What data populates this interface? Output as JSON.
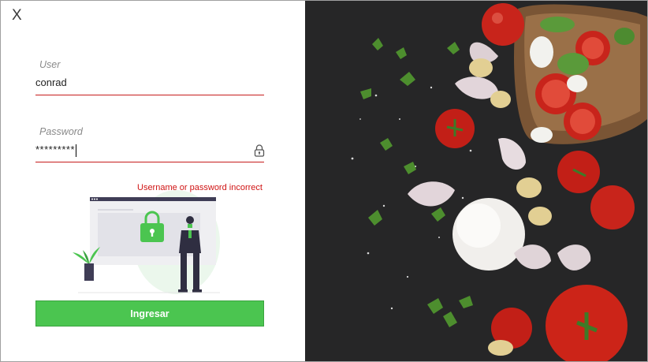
{
  "window": {
    "close_label": "X"
  },
  "form": {
    "user_label": "User",
    "user_value": "conrad",
    "password_label": "Password",
    "password_value": "*********",
    "error_message": "Username or password incorrect",
    "submit_label": "Ingresar"
  },
  "icons": {
    "password_toggle": "lock-icon",
    "illustration": "security-login-illustration",
    "photo": "food-ingredients-photo"
  },
  "colors": {
    "accent_green": "#4bc550",
    "error_red": "#d01414",
    "underline_red": "#c61c1c",
    "photo_background": "#262627"
  }
}
